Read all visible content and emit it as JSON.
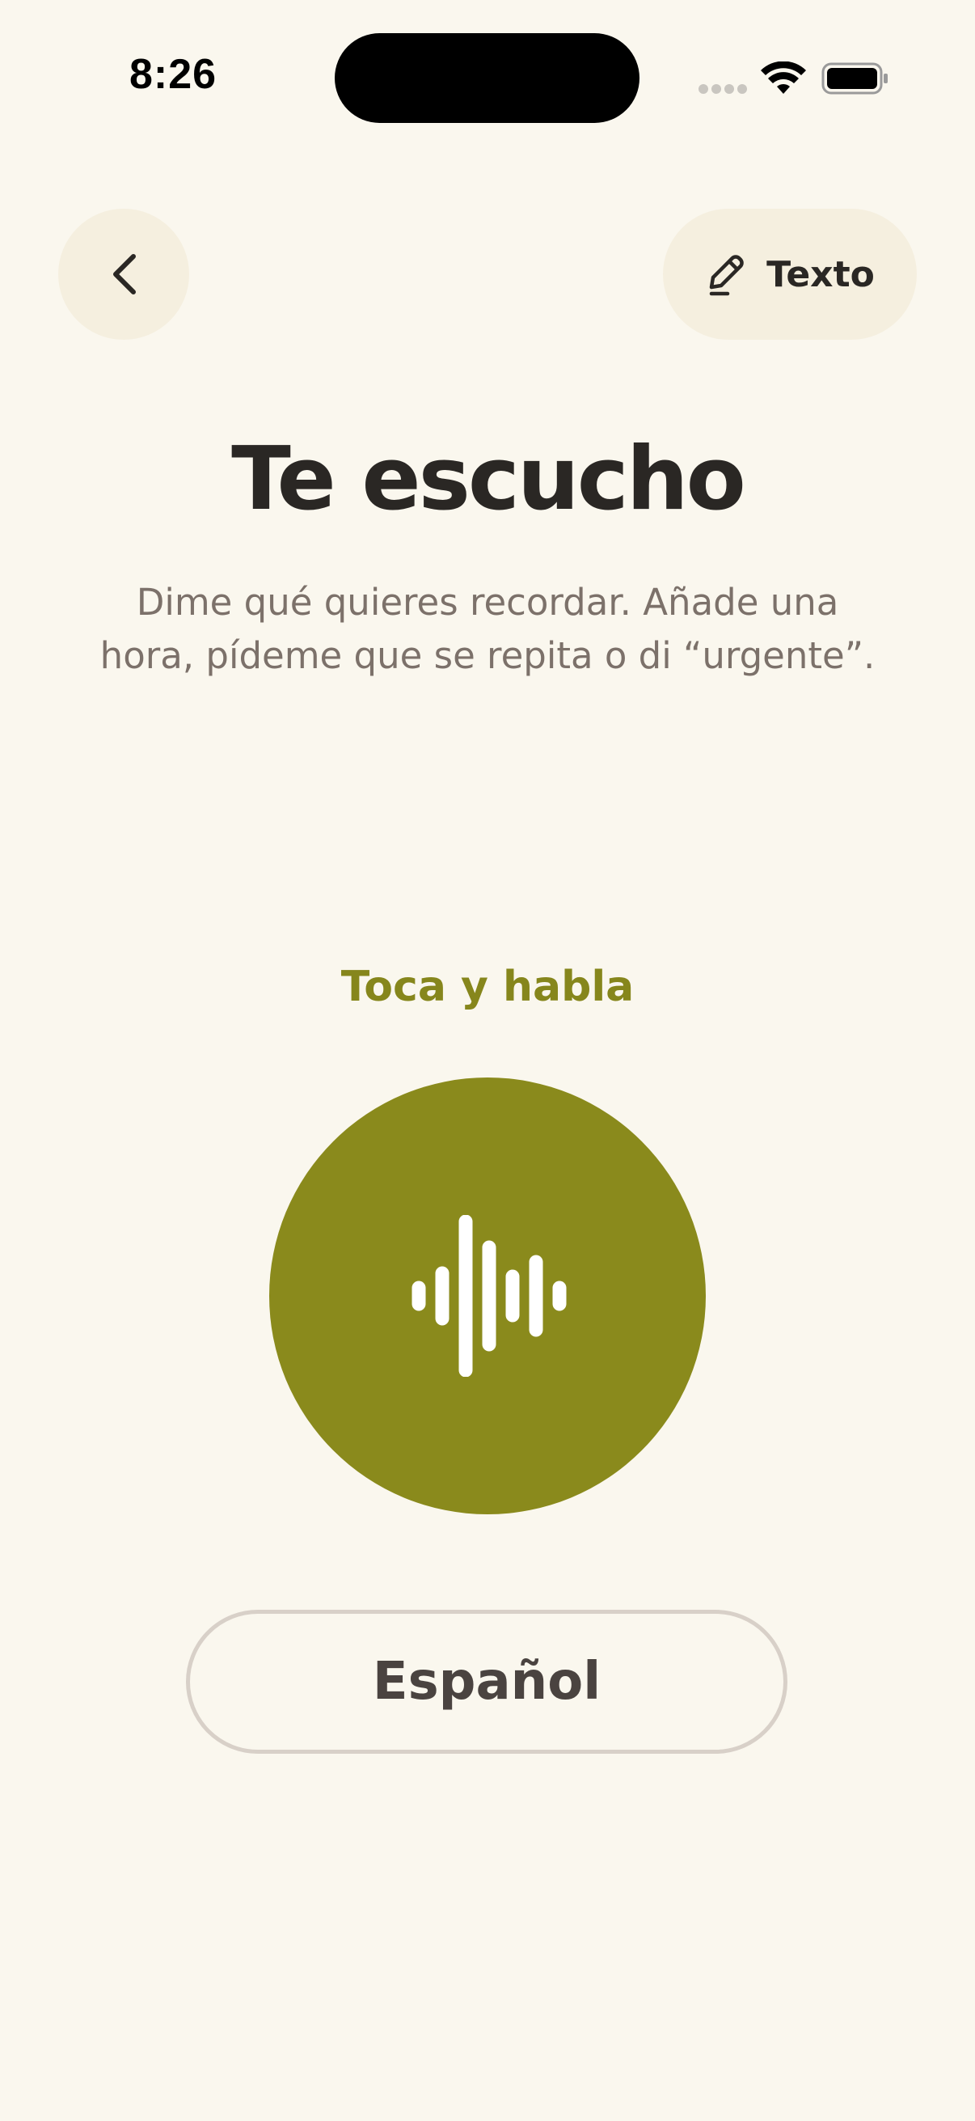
{
  "status_bar": {
    "time": "8:26"
  },
  "header": {
    "back_icon": "chevron-left-icon",
    "text_button": {
      "icon": "pencil-icon",
      "label": "Texto"
    }
  },
  "main": {
    "title": "Te escucho",
    "subtitle": "Dime qué quieres recordar. Añade una hora, pídeme que se repita o di “urgente”.",
    "prompt": "Toca y habla",
    "mic_icon": "waveform-icon"
  },
  "language": {
    "label": "Español"
  },
  "colors": {
    "background": "#FAF7EE",
    "accent": "#8A8A1C",
    "button_surface": "#F5EFDF",
    "text_primary": "#2A2724",
    "text_secondary": "#7C716A"
  }
}
